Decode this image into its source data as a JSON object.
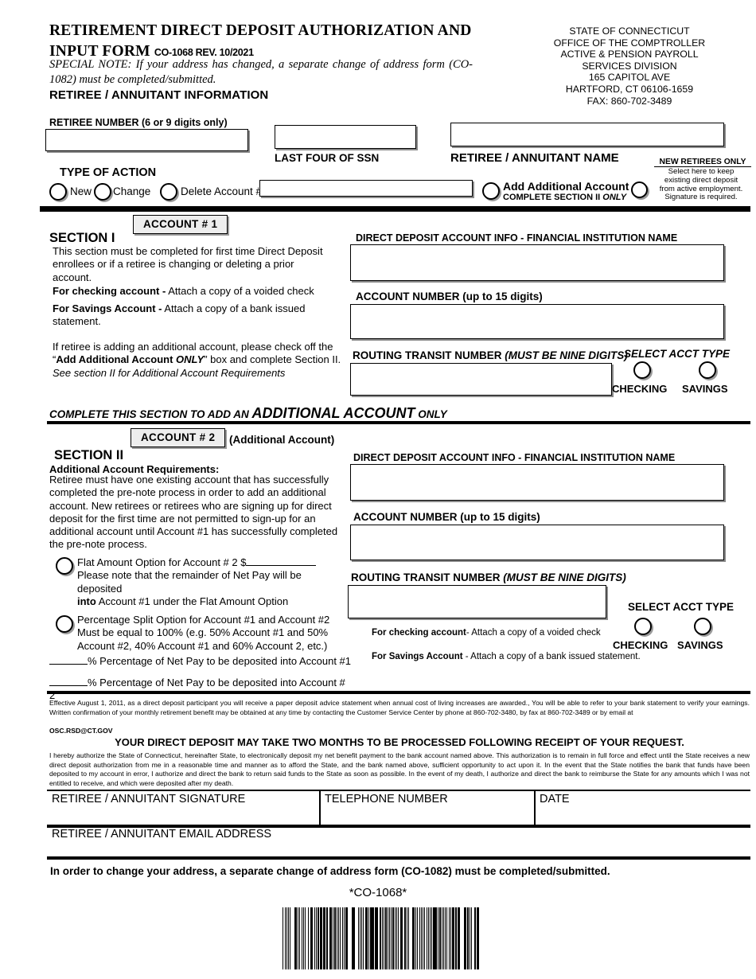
{
  "header": {
    "title_line1": "RETIREMENT DIRECT DEPOSIT AUTHORIZATION AND INPUT",
    "title_line2": "FORM",
    "form_number": "CO-1068  REV. 10/2021",
    "special_note": "SPECIAL NOTE: If your address has changed, a separate change of address form (CO-1082) must be completed/submitted.",
    "section_label": "RETIREE / ANNUITANT INFORMATION",
    "agency_address": [
      "STATE OF CONNECTICUT",
      "OFFICE OF THE COMPTROLLER",
      "ACTIVE & PENSION PAYROLL",
      "SERVICES DIVISION",
      "165 CAPITOL AVE",
      "HARTFORD, CT  06106-1659",
      "FAX: 860-702-3489"
    ]
  },
  "identity": {
    "retiree_number_label": "RETIREE NUMBER (6 or 9 digits only)",
    "retiree_number_value": "",
    "last_four_ssn_label": "LAST FOUR OF SSN",
    "last_four_ssn_value": "",
    "retiree_name_label": "RETIREE  /  ANNUITANT NAME",
    "retiree_name_value": ""
  },
  "type_of_action": {
    "heading": "TYPE OF ACTION",
    "options": [
      {
        "label": "New"
      },
      {
        "label": "Change"
      },
      {
        "label": "Delete Account #"
      }
    ],
    "delete_account_value": "",
    "add_additional": {
      "line1": "Add Additional Account",
      "line2": "COMPLETE SECTION II",
      "line2_italic": "ONLY"
    },
    "new_retirees": {
      "heading": "NEW RETIREES ONLY",
      "lines": [
        "Select here to keep",
        "existing direct deposit",
        "from active employment.",
        "Signature is required."
      ]
    }
  },
  "section1": {
    "account_tag": "ACCOUNT #  1",
    "heading": "SECTION I",
    "paragraph1": "This section must be completed for first time Direct Deposit enrollees or if a retiree is changing or deleting a prior account.",
    "checking_bold": "For checking account -",
    "checking_rest": " Attach a copy of a voided check",
    "savings_bold": "For Savings Account -",
    "savings_rest": " Attach a copy of a bank issued statement.",
    "paragraph2_part1": "If retiree is adding an additional account, please check off the “",
    "paragraph2_bold": "Add Additional Account ",
    "paragraph2_bold_italic": "ONLY",
    "paragraph2_part2": "” box and complete Section II. ",
    "paragraph2_italic": "See section II for Additional Account Requirements",
    "bank_name_label": "DIRECT DEPOSIT ACCOUNT INFO - FINANCIAL INSTITUTION NAME",
    "bank_name_value": "",
    "account_number_label": "ACCOUNT NUMBER (up to 15 digits)",
    "account_number_value": "",
    "routing_label_bold": "ROUTING TRANSIT NUMBER ",
    "routing_label_italic": "(MUST BE NINE DIGITS)",
    "routing_value": "",
    "select_acct_type": "SELECT ACCT TYPE",
    "checking_label": "CHECKING",
    "savings_label": "SAVINGS"
  },
  "divider": {
    "complete_part1": "COMPLETE THIS SECTION TO ADD AN ",
    "complete_big": "ADDITIONAL ACCOUNT",
    "complete_part2": " ONLY"
  },
  "section2": {
    "account_tag": "ACCOUNT #  2",
    "additional_note": "(Additional Account)",
    "heading": "SECTION II",
    "requirements_heading": "Additional Account Requirements:",
    "requirements_text": "Retiree must have one existing account that has successfully completed the pre-note process in order to add an additional account. New retirees or retirees who are signing up for direct deposit for the first time are not permitted to sign-up for an additional account until Account #1 has successfully completed the pre-note process.",
    "flat_option": {
      "line1_pre": "Flat Amount Option for Account # 2 $",
      "line2": "Please note that the remainder of Net Pay will be deposited",
      "line3_bold": "into",
      "line3_rest": " Account #1 under the Flat Amount Option",
      "amount_value": ""
    },
    "percentage_option": {
      "line1": "Percentage Split Option for Account #1 and Account #2",
      "line2": "Must be equal to 100% (e.g. 50% Account #1 and 50%",
      "line3": "Account #2, 40% Account #1 and 60% Account 2, etc.)"
    },
    "pct_account1_label": "% Percentage of Net Pay to be deposited into Account #1",
    "pct_account1_value": "",
    "pct_account2_label": "% Percentage of Net Pay to be deposited into Account # 2",
    "pct_account2_value": "",
    "bank_name_label": "DIRECT DEPOSIT ACCOUNT INFO - FINANCIAL INSTITUTION NAME",
    "bank_name_value": "",
    "account_number_label": "ACCOUNT NUMBER (up to 15 digits)",
    "account_number_value": "",
    "routing_label_bold": "ROUTING TRANSIT NUMBER ",
    "routing_label_italic": "(MUST BE NINE DIGITS)",
    "routing_value": "",
    "checking_bold": "For checking account",
    "checking_rest": "- Attach a copy of a voided check",
    "savings_bold": "For Savings Account",
    "savings_rest": " - Attach a copy of a bank issued statement.",
    "select_acct_type": "SELECT ACCT TYPE",
    "checking_label": "CHECKING",
    "savings_label": "SAVINGS"
  },
  "footer": {
    "effective_notice": "Effective August 1, 2011, as a direct deposit participant you will receive a paper deposit advice statement when annual cost of living increases are awarded., You will be able to refer to your bank statement to verify your earnings. Written confirmation of your monthly retirement benefit may be obtained at any time by contacting  the Customer Service Center by phone at 860-702-3480, by fax at 860-702-3489 or by email at",
    "email": "OSC.RSD@CT.GOV",
    "warning": "YOUR DIRECT DEPOSIT MAY TAKE TWO MONTHS TO BE PROCESSED FOLLOWING RECEIPT OF YOUR REQUEST.",
    "authorization": "I hereby authorize the State of Connecticut, hereinafter State, to electronically deposit my net benefit payment to the bank account named above. This authorization is to remain in full force and effect until the State receives a new direct deposit authorization from me in a reasonable time and manner as to afford the State, and the bank named above, sufficient opportunity to act upon it. In the event that the State notifies the bank that funds have been deposited to my account in error, I authorize and direct the bank to return said funds to the State as soon as possible. In the event of my death, I authorize and direct the bank to reimburse the State for any amounts which I was not entitled to receive, and which were deposited after my death.",
    "signature_label": "RETIREE / ANNUITANT SIGNATURE",
    "signature_value": "",
    "telephone_label": "TELEPHONE NUMBER",
    "telephone_value": "",
    "date_label": "DATE",
    "date_value": "",
    "email_label": "RETIREE / ANNUITANT EMAIL ADDRESS",
    "email_value": "",
    "address_change_notice": "In order to change your address, a separate change of address form (CO-1082) must be completed/submitted.",
    "barcode_text": "*CO-1068*"
  }
}
